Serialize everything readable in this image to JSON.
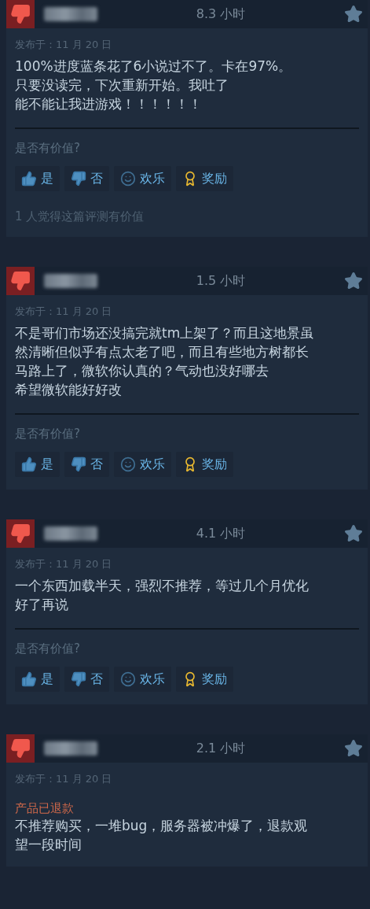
{
  "reviews": [
    {
      "recommended": false,
      "hours": "8.3 小时",
      "posted": "发布于：11 月 20 日",
      "refunded": false,
      "body_lines": [
        "100%进度蓝条花了6小说过不了。卡在97%。",
        "只要没读完，下次重新开始。我吐了",
        "能不能让我进游戏！！！！！！"
      ],
      "helpful_prompt": "是否有价值?",
      "buttons": [
        {
          "kind": "yes",
          "label": "是"
        },
        {
          "kind": "no",
          "label": "否"
        },
        {
          "kind": "funny",
          "label": "欢乐"
        },
        {
          "kind": "award",
          "label": "奖励"
        }
      ],
      "helpful_count": "1 人觉得这篇评测有价值"
    },
    {
      "recommended": false,
      "hours": "1.5 小时",
      "posted": "发布于：11 月 20 日",
      "refunded": false,
      "body_lines": [
        "不是哥们市场还没搞完就tm上架了？而且这地景虽",
        "然清晰但似乎有点太老了吧，而且有些地方树都长",
        "马路上了，微软你认真的？气动也没好哪去",
        "希望微软能好好改"
      ],
      "helpful_prompt": "是否有价值?",
      "buttons": [
        {
          "kind": "yes",
          "label": "是"
        },
        {
          "kind": "no",
          "label": "否"
        },
        {
          "kind": "funny",
          "label": "欢乐"
        },
        {
          "kind": "award",
          "label": "奖励"
        }
      ]
    },
    {
      "recommended": false,
      "hours": "4.1 小时",
      "posted": "发布于：11 月 20 日",
      "refunded": false,
      "body_lines": [
        "一个东西加载半天，强烈不推荐，等过几个月优化",
        "好了再说"
      ],
      "helpful_prompt": "是否有价值?",
      "buttons": [
        {
          "kind": "yes",
          "label": "是"
        },
        {
          "kind": "no",
          "label": "否"
        },
        {
          "kind": "funny",
          "label": "欢乐"
        },
        {
          "kind": "award",
          "label": "奖励"
        }
      ]
    },
    {
      "recommended": false,
      "hours": "2.1 小时",
      "posted": "发布于：11 月 20 日",
      "refunded": true,
      "refund_label": "产品已退款",
      "body_lines": [
        "不推荐购买，一堆bug，服务器被冲爆了，退款观",
        "望一段时间"
      ]
    }
  ]
}
